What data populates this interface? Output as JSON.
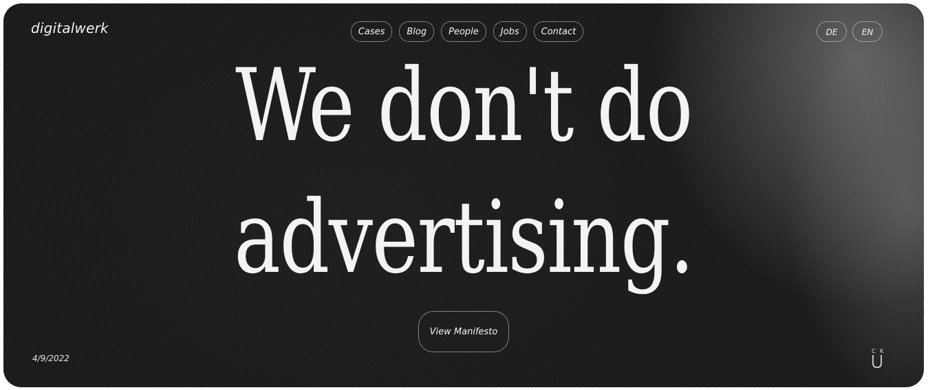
{
  "brand": {
    "logo": "digitalwerk"
  },
  "nav": {
    "items": [
      {
        "label": "Cases"
      },
      {
        "label": "Blog"
      },
      {
        "label": "People"
      },
      {
        "label": "Jobs"
      },
      {
        "label": "Contact"
      }
    ]
  },
  "language": {
    "options": [
      {
        "label": "DE"
      },
      {
        "label": "EN"
      }
    ]
  },
  "hero": {
    "line1": "We don't do",
    "line2": "advertising.",
    "cta_label": "View Manifesto"
  },
  "footer": {
    "date": "4/9/2022",
    "mark_letters": [
      "C",
      "K"
    ]
  },
  "colors": {
    "background": "#1c1c1c",
    "text": "#f3f3f3",
    "outer": "#ffffff"
  },
  "icons": {
    "corner_mark": "ck-u-monogram-icon"
  }
}
